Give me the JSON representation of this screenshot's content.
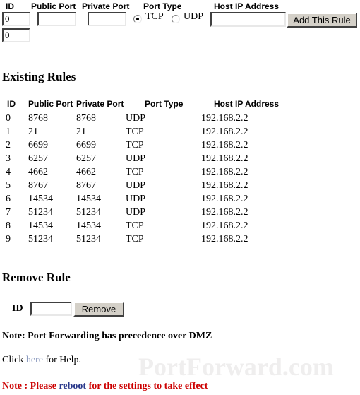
{
  "add_form": {
    "headers": {
      "id": "ID",
      "public_port": "Public Port",
      "private_port": "Private Port",
      "port_type": "Port Type",
      "host_ip": "Host IP Address"
    },
    "id_value_1": "0",
    "id_value_2": "0",
    "public_port_value": "",
    "private_port_value": "",
    "host_ip_value": "",
    "port_type_options": [
      "TCP",
      "UDP"
    ],
    "port_type_selected": "TCP",
    "tcp_label": "TCP",
    "udp_label": "UDP",
    "add_button_label": "Add This Rule"
  },
  "existing_rules": {
    "title": "Existing Rules",
    "columns": [
      "ID",
      "Public Port",
      "Private Port",
      "Port Type",
      "Host IP Address"
    ],
    "rows": [
      {
        "id": "0",
        "public_port": "8768",
        "private_port": "8768",
        "port_type": "UDP",
        "host_ip": "192.168.2.2"
      },
      {
        "id": "1",
        "public_port": "21",
        "private_port": "21",
        "port_type": "TCP",
        "host_ip": "192.168.2.2"
      },
      {
        "id": "2",
        "public_port": "6699",
        "private_port": "6699",
        "port_type": "TCP",
        "host_ip": "192.168.2.2"
      },
      {
        "id": "3",
        "public_port": "6257",
        "private_port": "6257",
        "port_type": "UDP",
        "host_ip": "192.168.2.2"
      },
      {
        "id": "4",
        "public_port": "4662",
        "private_port": "4662",
        "port_type": "TCP",
        "host_ip": "192.168.2.2"
      },
      {
        "id": "5",
        "public_port": "8767",
        "private_port": "8767",
        "port_type": "UDP",
        "host_ip": "192.168.2.2"
      },
      {
        "id": "6",
        "public_port": "14534",
        "private_port": "14534",
        "port_type": "UDP",
        "host_ip": "192.168.2.2"
      },
      {
        "id": "7",
        "public_port": "51234",
        "private_port": "51234",
        "port_type": "UDP",
        "host_ip": "192.168.2.2"
      },
      {
        "id": "8",
        "public_port": "14534",
        "private_port": "14534",
        "port_type": "TCP",
        "host_ip": "192.168.2.2"
      },
      {
        "id": "9",
        "public_port": "51234",
        "private_port": "51234",
        "port_type": "TCP",
        "host_ip": "192.168.2.2"
      }
    ]
  },
  "remove_rule": {
    "title": "Remove Rule",
    "id_label": "ID",
    "id_value": "",
    "button_label": "Remove"
  },
  "footer": {
    "note_dmz": "Note: Port Forwarding has precedence over DMZ",
    "help_prefix": "Click ",
    "help_link": "here",
    "help_suffix": " for Help.",
    "reboot_prefix": "Note : Please ",
    "reboot_link": "reboot",
    "reboot_suffix": " for the settings to take effect",
    "watermark": "PortForward.com"
  }
}
